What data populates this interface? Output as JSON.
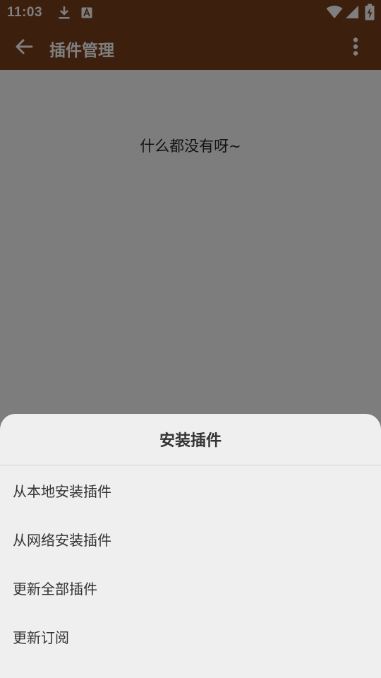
{
  "status_bar": {
    "time": "11:03",
    "icons": [
      "download-icon",
      "text-a-icon",
      "wifi-icon",
      "signal-icon",
      "battery-icon"
    ]
  },
  "app_bar": {
    "title": "插件管理",
    "back_icon": "back-arrow-icon",
    "more_icon": "more-vert-icon",
    "background_color": "#7a3f1b"
  },
  "content": {
    "empty_message": "什么都没有呀~"
  },
  "bottom_sheet": {
    "title": "安装插件",
    "items": [
      {
        "label": "从本地安装插件"
      },
      {
        "label": "从网络安装插件"
      },
      {
        "label": "更新全部插件"
      },
      {
        "label": "更新订阅"
      }
    ]
  }
}
